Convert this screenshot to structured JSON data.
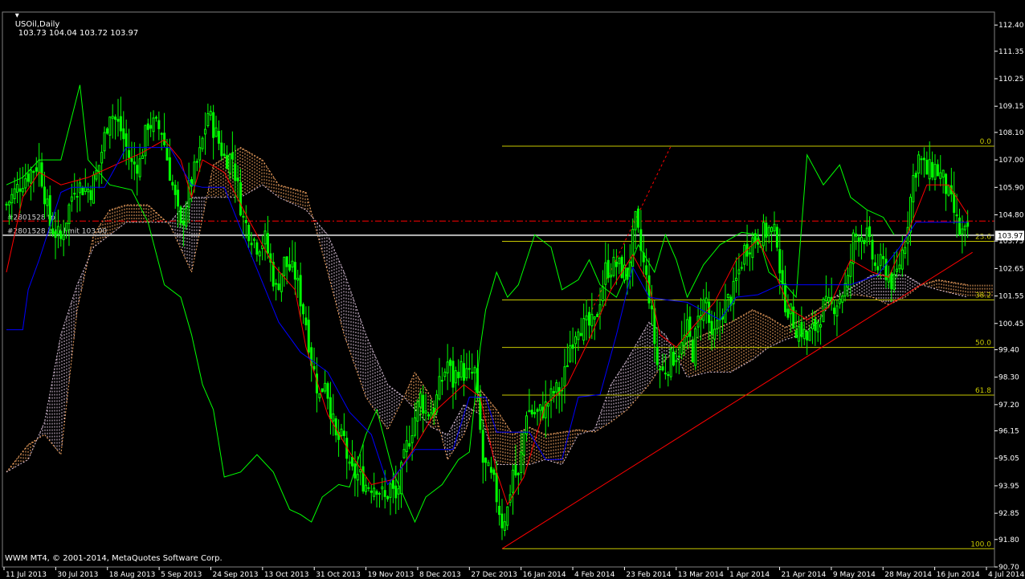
{
  "window": {
    "symbol_tf": "USOil,Daily",
    "ohlc": "103.73 104.04 103.72 103.97",
    "copyright": "WWM MT4, © 2001-2014, MetaQuotes Software Corp."
  },
  "colors": {
    "background": "#000000",
    "axis": "#ffffff",
    "candles": "#00ff00",
    "tenkan": "#ff0000",
    "kijun": "#0000ff",
    "chikou": "#00ff00",
    "cloud_up": "#f4a460",
    "cloud_down": "#d8bfd8",
    "fibo": "#c8c800",
    "trendline": "#ff0000",
    "order_line": "#ff0000",
    "bid_line": "#c0c0c0"
  },
  "chart_data": {
    "type": "candlestick",
    "symbol": "USOil",
    "timeframe": "Daily",
    "current": {
      "open": 103.73,
      "high": 104.04,
      "low": 103.72,
      "close": 103.97
    },
    "current_price_label": "103.97",
    "ylim": [
      90.7,
      112.92
    ],
    "y_ticks": [
      "112.40",
      "111.35",
      "110.25",
      "109.15",
      "108.10",
      "107.00",
      "105.90",
      "104.80",
      "103.75",
      "102.65",
      "101.55",
      "100.45",
      "99.40",
      "98.30",
      "97.20",
      "96.15",
      "95.05",
      "93.95",
      "92.85",
      "91.80",
      "90.70"
    ],
    "x_ticks": [
      "11 Jul 2013",
      "30 Jul 2013",
      "18 Aug 2013",
      "5 Sep 2013",
      "24 Sep 2013",
      "13 Oct 2013",
      "31 Oct 2013",
      "19 Nov 2013",
      "8 Dec 2013",
      "27 Dec 2013",
      "16 Jan 2014",
      "4 Feb 2014",
      "23 Feb 2014",
      "13 Mar 2014",
      "1 Apr 2014",
      "21 Apr 2014",
      "9 May 2014",
      "28 May 2014",
      "16 Jun 2014",
      "4 Jul 2014"
    ],
    "close_path": [
      [
        0,
        105.2
      ],
      [
        6,
        106.2
      ],
      [
        12,
        106.9
      ],
      [
        16,
        104.4
      ],
      [
        20,
        103.8
      ],
      [
        25,
        106.0
      ],
      [
        31,
        105.8
      ],
      [
        34,
        106.8
      ],
      [
        38,
        109.0
      ],
      [
        42,
        108.2
      ],
      [
        46,
        106.8
      ],
      [
        49,
        106.9
      ],
      [
        52,
        108.5
      ],
      [
        57,
        108.2
      ],
      [
        62,
        105.4
      ],
      [
        64,
        104.2
      ],
      [
        67,
        105.8
      ],
      [
        71,
        107.2
      ],
      [
        74,
        108.9
      ],
      [
        80,
        107.1
      ],
      [
        83,
        107.1
      ],
      [
        87,
        104.6
      ],
      [
        92,
        103.6
      ],
      [
        95,
        103.8
      ],
      [
        99,
        101.8
      ],
      [
        102,
        102.9
      ],
      [
        106,
        102.4
      ],
      [
        110,
        100.5
      ],
      [
        112,
        99.0
      ],
      [
        115,
        97.5
      ],
      [
        117,
        98.3
      ],
      [
        121,
        95.8
      ],
      [
        124,
        95.8
      ],
      [
        126,
        94.5
      ],
      [
        130,
        94.3
      ],
      [
        132,
        94.0
      ],
      [
        136,
        94.0
      ],
      [
        139,
        93.4
      ],
      [
        141,
        93.9
      ],
      [
        143,
        93.4
      ],
      [
        147,
        95.5
      ],
      [
        152,
        97.5
      ],
      [
        154,
        96.9
      ],
      [
        157,
        97.0
      ],
      [
        159,
        97.9
      ],
      [
        162,
        98.9
      ],
      [
        164,
        98.1
      ],
      [
        166,
        98.7
      ],
      [
        170,
        98.3
      ],
      [
        172,
        98.5
      ],
      [
        175,
        94.9
      ],
      [
        179,
        94.0
      ],
      [
        182,
        92.5
      ],
      [
        184,
        93.0
      ],
      [
        186,
        94.6
      ],
      [
        188,
        94.2
      ],
      [
        191,
        97.0
      ],
      [
        195,
        96.8
      ],
      [
        198,
        97.1
      ],
      [
        201,
        97.7
      ],
      [
        204,
        97.8
      ],
      [
        207,
        99.6
      ],
      [
        210,
        100.5
      ],
      [
        212,
        100.3
      ],
      [
        216,
        100.4
      ],
      [
        220,
        102.6
      ],
      [
        224,
        102.8
      ],
      [
        228,
        102.4
      ],
      [
        231,
        104.5
      ],
      [
        234,
        102.8
      ],
      [
        236,
        101.6
      ],
      [
        239,
        98.8
      ],
      [
        241,
        98.5
      ],
      [
        244,
        99.0
      ],
      [
        248,
        99.5
      ],
      [
        250,
        100.2
      ],
      [
        252,
        99.3
      ],
      [
        255,
        101.1
      ],
      [
        257,
        101.4
      ],
      [
        259,
        99.6
      ],
      [
        263,
        101.0
      ],
      [
        267,
        101.7
      ],
      [
        271,
        103.4
      ],
      [
        274,
        103.8
      ],
      [
        277,
        104.0
      ],
      [
        280,
        104.2
      ],
      [
        283,
        103.9
      ],
      [
        285,
        101.6
      ],
      [
        290,
        100.3
      ],
      [
        292,
        100.2
      ],
      [
        294,
        99.8
      ],
      [
        297,
        100.3
      ],
      [
        300,
        101.1
      ],
      [
        303,
        101.1
      ],
      [
        306,
        101.5
      ],
      [
        309,
        102.1
      ],
      [
        311,
        103.8
      ],
      [
        313,
        104.1
      ],
      [
        316,
        103.9
      ],
      [
        319,
        102.7
      ],
      [
        322,
        102.8
      ],
      [
        324,
        102.3
      ],
      [
        326,
        102.0
      ],
      [
        330,
        103.8
      ],
      [
        333,
        106.3
      ],
      [
        335,
        107.1
      ],
      [
        338,
        106.5
      ],
      [
        341,
        106.7
      ],
      [
        344,
        106.2
      ],
      [
        348,
        104.9
      ],
      [
        350,
        104.1
      ],
      [
        353,
        103.97
      ]
    ],
    "tenkan_path": [
      [
        0,
        102.5
      ],
      [
        6,
        105.5
      ],
      [
        12,
        106.5
      ],
      [
        20,
        106.0
      ],
      [
        30,
        106.3
      ],
      [
        40,
        106.8
      ],
      [
        50,
        107.3
      ],
      [
        58,
        107.8
      ],
      [
        64,
        107.0
      ],
      [
        68,
        105.5
      ],
      [
        72,
        107.0
      ],
      [
        80,
        106.5
      ],
      [
        88,
        104.8
      ],
      [
        98,
        102.8
      ],
      [
        106,
        101.8
      ],
      [
        110,
        99.5
      ],
      [
        118,
        96.8
      ],
      [
        126,
        95.3
      ],
      [
        134,
        94.0
      ],
      [
        142,
        94.2
      ],
      [
        150,
        95.5
      ],
      [
        158,
        97.0
      ],
      [
        168,
        98.0
      ],
      [
        174,
        97.5
      ],
      [
        180,
        94.5
      ],
      [
        184,
        93.2
      ],
      [
        190,
        94.3
      ],
      [
        198,
        97.2
      ],
      [
        206,
        98.0
      ],
      [
        214,
        99.8
      ],
      [
        222,
        101.8
      ],
      [
        230,
        103.2
      ],
      [
        236,
        102.0
      ],
      [
        240,
        100.0
      ],
      [
        246,
        99.5
      ],
      [
        252,
        100.3
      ],
      [
        260,
        101.3
      ],
      [
        268,
        103.0
      ],
      [
        276,
        103.8
      ],
      [
        282,
        102.5
      ],
      [
        288,
        101.0
      ],
      [
        294,
        100.6
      ],
      [
        302,
        101.1
      ],
      [
        310,
        103.0
      ],
      [
        318,
        102.5
      ],
      [
        324,
        102.3
      ],
      [
        330,
        103.8
      ],
      [
        338,
        106.0
      ],
      [
        346,
        106.0
      ],
      [
        353,
        104.8
      ]
    ],
    "kijun_path": [
      [
        0,
        100.2
      ],
      [
        6,
        100.2
      ],
      [
        8,
        101.8
      ],
      [
        12,
        103.0
      ],
      [
        20,
        105.7
      ],
      [
        24,
        105.9
      ],
      [
        36,
        105.9
      ],
      [
        44,
        107.5
      ],
      [
        60,
        107.5
      ],
      [
        68,
        106.0
      ],
      [
        72,
        105.9
      ],
      [
        80,
        105.9
      ],
      [
        88,
        103.7
      ],
      [
        100,
        100.5
      ],
      [
        108,
        99.3
      ],
      [
        118,
        98.5
      ],
      [
        126,
        96.9
      ],
      [
        134,
        96.0
      ],
      [
        140,
        94.0
      ],
      [
        146,
        94.8
      ],
      [
        150,
        95.4
      ],
      [
        156,
        95.4
      ],
      [
        164,
        95.4
      ],
      [
        170,
        97.5
      ],
      [
        176,
        97.5
      ],
      [
        180,
        96.1
      ],
      [
        192,
        96.1
      ],
      [
        198,
        95.0
      ],
      [
        204,
        95.0
      ],
      [
        210,
        97.5
      ],
      [
        218,
        97.6
      ],
      [
        224,
        100.0
      ],
      [
        230,
        102.7
      ],
      [
        236,
        101.5
      ],
      [
        242,
        101.4
      ],
      [
        250,
        101.3
      ],
      [
        262,
        100.6
      ],
      [
        268,
        101.5
      ],
      [
        276,
        101.6
      ],
      [
        284,
        102.0
      ],
      [
        292,
        102.0
      ],
      [
        300,
        102.0
      ],
      [
        310,
        102.0
      ],
      [
        320,
        102.4
      ],
      [
        328,
        103.5
      ],
      [
        334,
        104.5
      ],
      [
        346,
        104.5
      ],
      [
        353,
        104.5
      ]
    ],
    "chikou_path": [
      [
        0,
        106.0
      ],
      [
        6,
        106.3
      ],
      [
        12,
        107.0
      ],
      [
        20,
        107.0
      ],
      [
        27,
        110.0
      ],
      [
        30,
        107.0
      ],
      [
        38,
        106.0
      ],
      [
        46,
        105.8
      ],
      [
        52,
        104.5
      ],
      [
        58,
        102.0
      ],
      [
        64,
        101.5
      ],
      [
        68,
        100.0
      ],
      [
        72,
        98.0
      ],
      [
        76,
        97.0
      ],
      [
        80,
        94.3
      ],
      [
        86,
        94.5
      ],
      [
        92,
        95.2
      ],
      [
        98,
        94.5
      ],
      [
        104,
        93.0
      ],
      [
        108,
        92.8
      ],
      [
        112,
        92.5
      ],
      [
        116,
        93.5
      ],
      [
        122,
        94.0
      ],
      [
        126,
        93.9
      ],
      [
        132,
        96.0
      ],
      [
        136,
        97.0
      ],
      [
        142,
        94.5
      ],
      [
        146,
        93.5
      ],
      [
        150,
        92.5
      ],
      [
        154,
        93.5
      ],
      [
        160,
        94.0
      ],
      [
        166,
        95.0
      ],
      [
        170,
        95.3
      ],
      [
        174,
        99.5
      ],
      [
        176,
        101.0
      ],
      [
        180,
        102.5
      ],
      [
        184,
        101.5
      ],
      [
        188,
        102.0
      ],
      [
        194,
        104.0
      ],
      [
        200,
        103.5
      ],
      [
        204,
        101.8
      ],
      [
        210,
        102.2
      ],
      [
        214,
        103.0
      ],
      [
        218,
        102.0
      ],
      [
        224,
        101.5
      ],
      [
        228,
        102.5
      ],
      [
        232,
        103.6
      ],
      [
        238,
        102.5
      ],
      [
        242,
        104.0
      ],
      [
        246,
        103.0
      ],
      [
        250,
        101.5
      ],
      [
        256,
        102.8
      ],
      [
        262,
        103.6
      ],
      [
        270,
        104.1
      ],
      [
        276,
        104.0
      ],
      [
        280,
        102.5
      ],
      [
        286,
        102.0
      ],
      [
        290,
        101.5
      ],
      [
        294,
        107.2
      ],
      [
        300,
        106.0
      ],
      [
        306,
        106.8
      ],
      [
        310,
        105.5
      ],
      [
        316,
        105.0
      ],
      [
        322,
        104.7
      ],
      [
        326,
        104.0
      ]
    ],
    "span_a_path": [
      [
        0,
        94.5
      ],
      [
        8,
        95.6
      ],
      [
        14,
        96.0
      ],
      [
        20,
        95.2
      ],
      [
        26,
        101.0
      ],
      [
        32,
        104.0
      ],
      [
        38,
        105.0
      ],
      [
        44,
        105.2
      ],
      [
        52,
        105.2
      ],
      [
        60,
        104.4
      ],
      [
        68,
        102.5
      ],
      [
        76,
        106.8
      ],
      [
        86,
        107.5
      ],
      [
        94,
        107.0
      ],
      [
        100,
        106.0
      ],
      [
        110,
        105.7
      ],
      [
        118,
        102.5
      ],
      [
        124,
        100.0
      ],
      [
        132,
        97.5
      ],
      [
        140,
        96.2
      ],
      [
        146,
        97.5
      ],
      [
        150,
        98.5
      ],
      [
        156,
        97.5
      ],
      [
        162,
        95.0
      ],
      [
        168,
        96.0
      ],
      [
        174,
        97.8
      ],
      [
        180,
        97.0
      ],
      [
        186,
        96.0
      ],
      [
        192,
        96.3
      ],
      [
        198,
        96.0
      ],
      [
        204,
        96.1
      ],
      [
        210,
        96.2
      ],
      [
        216,
        96.1
      ],
      [
        222,
        96.5
      ],
      [
        228,
        97.0
      ],
      [
        236,
        98.0
      ],
      [
        242,
        99.0
      ],
      [
        250,
        99.7
      ],
      [
        258,
        100.1
      ],
      [
        266,
        100.5
      ],
      [
        274,
        101.0
      ],
      [
        280,
        100.7
      ],
      [
        286,
        100.3
      ],
      [
        292,
        100.6
      ],
      [
        298,
        101.0
      ],
      [
        304,
        101.5
      ],
      [
        312,
        101.6
      ],
      [
        318,
        101.5
      ],
      [
        324,
        101.2
      ],
      [
        330,
        101.5
      ],
      [
        336,
        102.0
      ],
      [
        342,
        102.2
      ],
      [
        353,
        102.0
      ]
    ],
    "span_b_path": [
      [
        0,
        94.5
      ],
      [
        8,
        95.0
      ],
      [
        14,
        96.5
      ],
      [
        20,
        100.0
      ],
      [
        26,
        102.0
      ],
      [
        32,
        103.5
      ],
      [
        38,
        104.0
      ],
      [
        44,
        104.5
      ],
      [
        52,
        104.5
      ],
      [
        60,
        104.5
      ],
      [
        68,
        105.5
      ],
      [
        76,
        105.5
      ],
      [
        86,
        105.5
      ],
      [
        94,
        106.0
      ],
      [
        100,
        105.5
      ],
      [
        110,
        105.0
      ],
      [
        118,
        104.0
      ],
      [
        124,
        102.5
      ],
      [
        132,
        100.0
      ],
      [
        140,
        98.0
      ],
      [
        146,
        97.5
      ],
      [
        150,
        97.0
      ],
      [
        156,
        96.3
      ],
      [
        162,
        96.0
      ],
      [
        168,
        97.2
      ],
      [
        174,
        96.8
      ],
      [
        180,
        94.8
      ],
      [
        186,
        94.8
      ],
      [
        192,
        94.8
      ],
      [
        198,
        95.0
      ],
      [
        204,
        94.8
      ],
      [
        210,
        96.0
      ],
      [
        216,
        96.2
      ],
      [
        222,
        98.0
      ],
      [
        228,
        99.0
      ],
      [
        236,
        100.5
      ],
      [
        242,
        100.0
      ],
      [
        250,
        98.3
      ],
      [
        258,
        98.5
      ],
      [
        266,
        98.5
      ],
      [
        274,
        99.0
      ],
      [
        280,
        99.5
      ],
      [
        286,
        99.8
      ],
      [
        292,
        100.0
      ],
      [
        298,
        100.5
      ],
      [
        304,
        101.5
      ],
      [
        312,
        102.0
      ],
      [
        318,
        102.4
      ],
      [
        324,
        102.4
      ],
      [
        330,
        102.4
      ],
      [
        336,
        102.0
      ],
      [
        342,
        101.8
      ],
      [
        353,
        101.5
      ]
    ],
    "fibonacci": {
      "high": 107.55,
      "low": 91.43,
      "levels": [
        {
          "label": "0.0",
          "price": 107.55
        },
        {
          "label": "23.6",
          "price": 103.74
        },
        {
          "label": "38.2",
          "price": 101.39
        },
        {
          "label": "50.0",
          "price": 99.49
        },
        {
          "label": "61.8",
          "price": 97.58
        },
        {
          "label": "100.0",
          "price": 91.43
        }
      ]
    },
    "trendline": {
      "from": [
        182,
        91.43
      ],
      "to": [
        353,
        103.3
      ]
    },
    "trendline_projection": {
      "from": [
        215,
        101.0
      ],
      "to": [
        244,
        107.55
      ]
    },
    "order_lines": [
      {
        "label": "#2801528 tp",
        "price": 104.55
      },
      {
        "label": "#2801528 buy limit 103.00",
        "price": 104.0
      }
    ]
  }
}
